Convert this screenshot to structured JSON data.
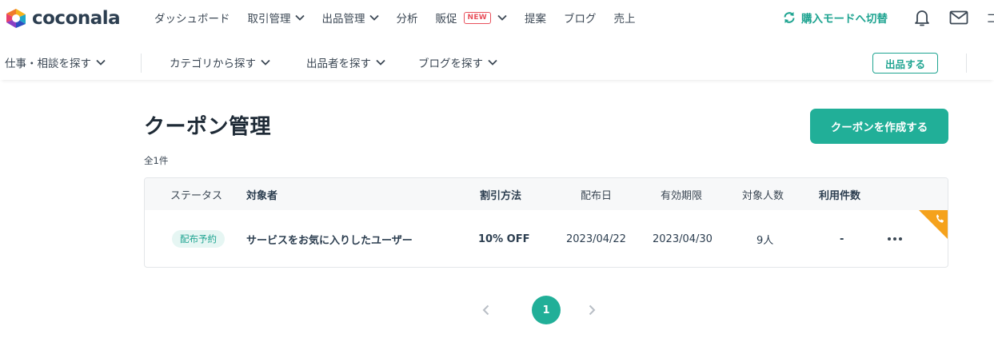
{
  "header": {
    "logo_text": "coconala",
    "nav": [
      {
        "label": "ダッシュボード",
        "dropdown": false
      },
      {
        "label": "取引管理",
        "dropdown": true
      },
      {
        "label": "出品管理",
        "dropdown": true
      },
      {
        "label": "分析",
        "dropdown": false
      },
      {
        "label": "販促",
        "dropdown": true,
        "badge": "NEW"
      },
      {
        "label": "提案",
        "dropdown": false
      },
      {
        "label": "ブログ",
        "dropdown": false
      },
      {
        "label": "売上",
        "dropdown": false
      }
    ],
    "mode_switch_label": "購入モードへ切替",
    "cut_off_text": "コ"
  },
  "subnav": {
    "items": [
      "仕事・相談を探す",
      "カテゴリから探す",
      "出品者を探す",
      "ブログを探す"
    ],
    "sell_button": "出品する"
  },
  "content": {
    "title": "クーポン管理",
    "create_button": "クーポンを作成する",
    "count": "全1件",
    "table": {
      "headers": {
        "status": "ステータス",
        "target": "対象者",
        "discount": "割引方法",
        "distribution_date": "配布日",
        "expiry": "有効期限",
        "target_count": "対象人数",
        "usage_count": "利用件数"
      },
      "rows": [
        {
          "status": "配布予約",
          "target": "サービスをお気に入りしたユーザー",
          "discount": "10% OFF",
          "distribution_date": "2023/04/22",
          "expiry": "2023/04/30",
          "target_count": "9人",
          "usage_count": "-"
        }
      ]
    }
  },
  "pagination": {
    "current": "1"
  },
  "colors": {
    "accent": "#21af98",
    "badge_new": "#e8505b",
    "corner": "#f5a21c"
  }
}
